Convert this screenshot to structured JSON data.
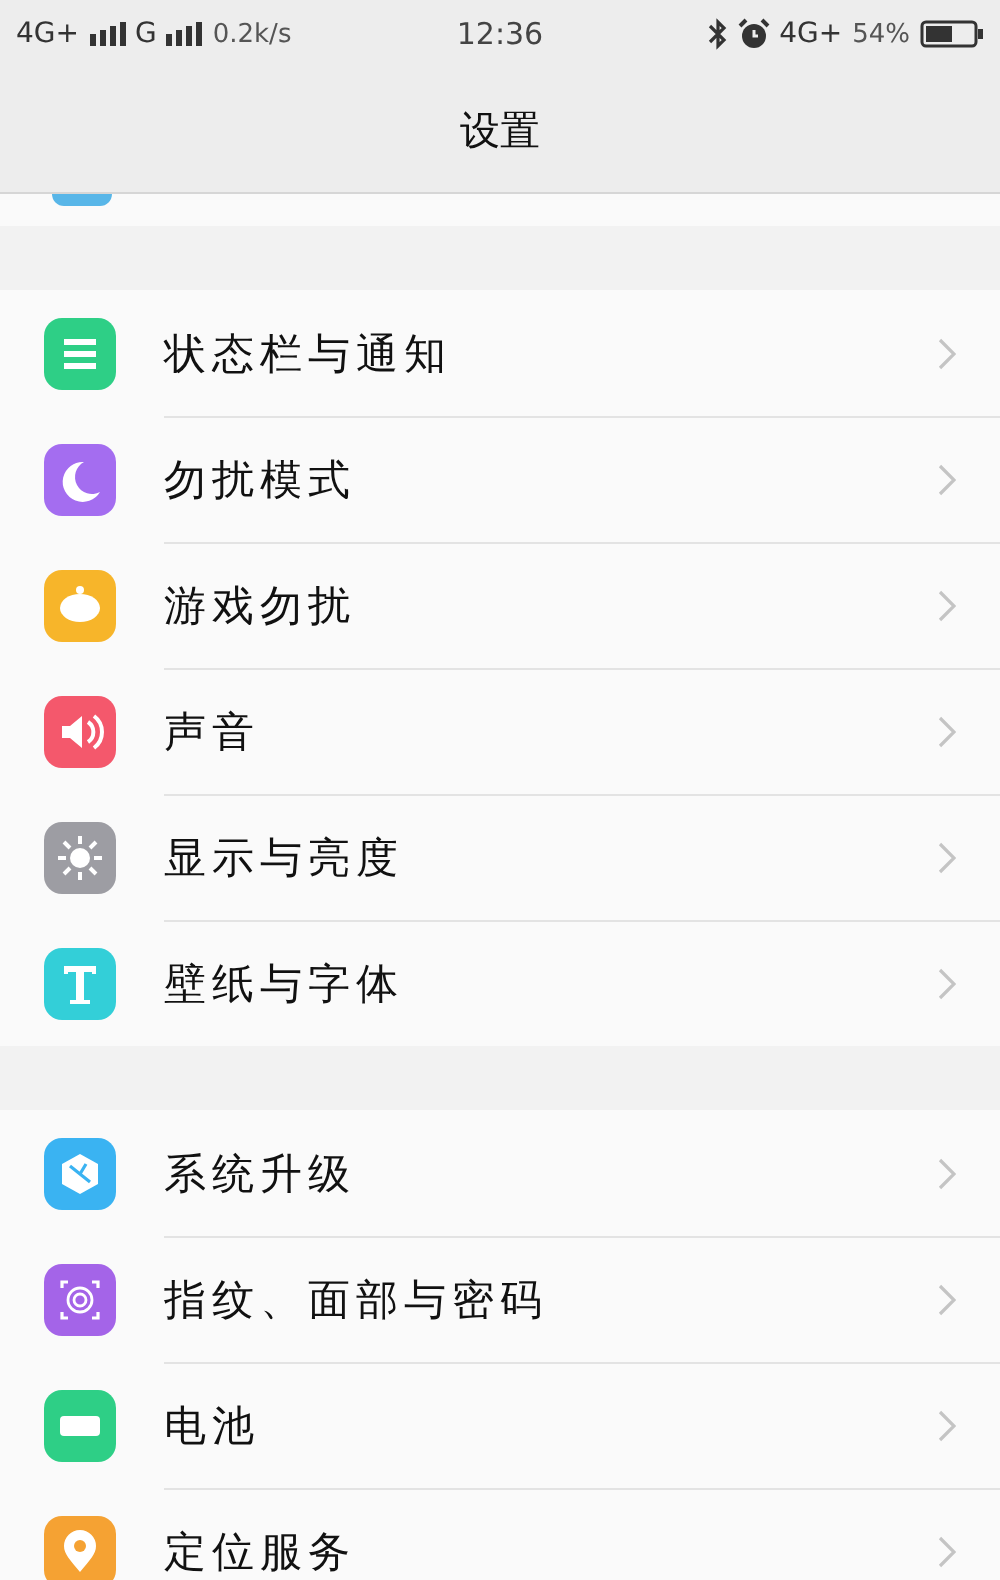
{
  "status_bar": {
    "left": [
      {
        "kind": "text",
        "text": "4G+"
      },
      {
        "kind": "signal"
      },
      {
        "kind": "text",
        "text": "G"
      },
      {
        "kind": "signal"
      },
      {
        "kind": "speed",
        "text": "0.2k/s"
      }
    ],
    "time": "12:36",
    "right": [
      {
        "kind": "bluetooth"
      },
      {
        "kind": "alarm"
      },
      {
        "kind": "text",
        "text": "4G+"
      },
      {
        "kind": "speed",
        "text": "54%"
      },
      {
        "kind": "battery"
      }
    ]
  },
  "header": {
    "title": "设置"
  },
  "groups": [
    {
      "items": [
        {
          "kind": "list",
          "color": "#2ecf86",
          "label": "状态栏与通知"
        },
        {
          "kind": "moon",
          "color": "#a46df0",
          "label": "勿扰模式"
        },
        {
          "kind": "game",
          "color": "#f7b52a",
          "label": "游戏勿扰"
        },
        {
          "kind": "sound",
          "color": "#f4586c",
          "label": "声音"
        },
        {
          "kind": "sun",
          "color": "#9d9da3",
          "label": "显示与亮度"
        },
        {
          "kind": "text",
          "color": "#33cfd8",
          "label": "壁纸与字体"
        }
      ]
    },
    {
      "items": [
        {
          "kind": "cube",
          "color": "#3ab3f2",
          "label": "系统升级"
        },
        {
          "kind": "fingerprint",
          "color": "#a464e8",
          "label": "指纹、面部与密码"
        },
        {
          "kind": "battery",
          "color": "#2ecf86",
          "label": "电池"
        },
        {
          "kind": "pin",
          "color": "#f5a233",
          "label": "定位服务"
        }
      ]
    }
  ]
}
